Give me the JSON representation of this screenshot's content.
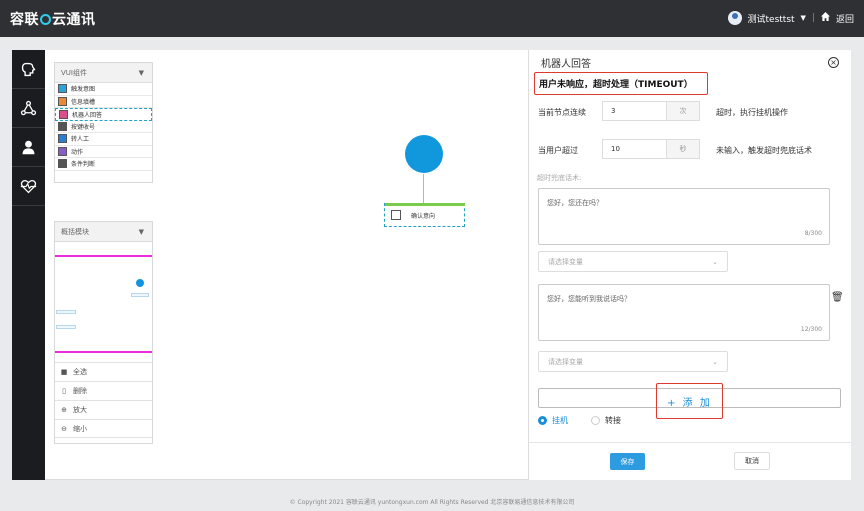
{
  "header": {
    "brand_part1": "容联",
    "brand_part2": "云通讯",
    "username": "测试testtst",
    "dropdown_arrow": "▼",
    "separator": "|",
    "back_label": "返回"
  },
  "rail": {
    "items": [
      {
        "icon": "brain-icon"
      },
      {
        "icon": "network-icon"
      },
      {
        "icon": "user-icon"
      },
      {
        "icon": "heart-pulse-icon"
      }
    ]
  },
  "palette": {
    "title": "VUI组件",
    "items": [
      {
        "label": "触发意图",
        "color": "#2ba3d8"
      },
      {
        "label": "信息填槽",
        "color": "#e88a3a"
      },
      {
        "label": "机器人回答",
        "color": "#d94f8a"
      },
      {
        "label": "按键收号",
        "color": "#555555"
      },
      {
        "label": "转人工",
        "color": "#2a7fd1"
      },
      {
        "label": "动作",
        "color": "#8a5cc8"
      },
      {
        "label": "条件判断",
        "color": "#555555"
      }
    ]
  },
  "outline": {
    "title": "概括模块",
    "actions": [
      {
        "icon": "trash-icon",
        "label": "全选"
      },
      {
        "icon": "trash-outline-icon",
        "label": "删除"
      },
      {
        "icon": "zoom-in-icon",
        "label": "放大"
      },
      {
        "icon": "zoom-out-icon",
        "label": "缩小"
      }
    ]
  },
  "flow": {
    "node_label": "确认意向"
  },
  "panel": {
    "title": "机器人回答",
    "subtitle": "用户未响应，超时处理（TIMEOUT）",
    "row1": {
      "prefix": "当前节点连续",
      "value": "3",
      "unit": "次",
      "suffix": "超时，执行挂机操作"
    },
    "row2": {
      "prefix": "当用户超过",
      "value": "10",
      "unit": "秒",
      "suffix": "未输入，触发超时兜底话术"
    },
    "section_label": "超时兜底话术:",
    "script1": {
      "text": "您好，您还在吗？",
      "count": "8/300"
    },
    "variable_placeholder": "请选择变量",
    "script2": {
      "text": "您好，您能听到我说话吗？",
      "count": "12/300"
    },
    "add_label": "+ 添 加",
    "radio_hangup": "挂机",
    "radio_transfer": "转接",
    "save": "保存",
    "cancel": "取消"
  },
  "copyright": "© Copyright 2021   容联云通讯   yuntongxun.com   All Rights Reserved  北京容联易通信息技术有限公司"
}
